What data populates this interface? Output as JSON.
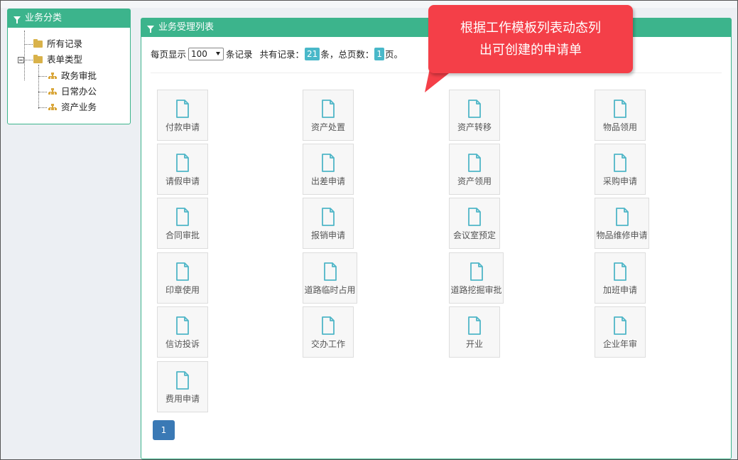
{
  "sidebar": {
    "title": "业务分类",
    "tree": [
      {
        "label": "所有记录",
        "icon": "folder-icon"
      },
      {
        "label": "表单类型",
        "icon": "folder-icon"
      },
      {
        "label": "政务审批",
        "icon": "org-chart-icon"
      },
      {
        "label": "日常办公",
        "icon": "org-chart-icon"
      },
      {
        "label": "资产业务",
        "icon": "org-chart-icon"
      }
    ]
  },
  "main": {
    "title": "业务受理列表",
    "pager": {
      "per_page_prefix": "每页显示",
      "per_page_value": "100",
      "per_page_suffix": "条记录",
      "total_prefix": "共有记录：",
      "total_count": "21",
      "total_suffix": "条，总页数：",
      "pages_count": "1",
      "pages_suffix": "页。"
    },
    "forms": [
      "付款申请",
      "资产处置",
      "资产转移",
      "物品领用",
      "请假申请",
      "出差申请",
      "资产领用",
      "采购申请",
      "合同审批",
      "报销申请",
      "会议室预定",
      "物品维修申请",
      "印章使用",
      "道路临时占用",
      "道路挖掘审批",
      "加班申请",
      "信访投诉",
      "交办工作",
      "开业",
      "企业年审",
      "费用申请"
    ],
    "current_page": "1"
  },
  "callout": {
    "line1": "根据工作模板列表动态列",
    "line2": "出可创建的申请单"
  },
  "colors": {
    "accent": "#3cb48c",
    "badge": "#49b8c9",
    "pagebtn": "#3a79b5",
    "callout": "#f43f48",
    "folder": "#d9b24a"
  }
}
